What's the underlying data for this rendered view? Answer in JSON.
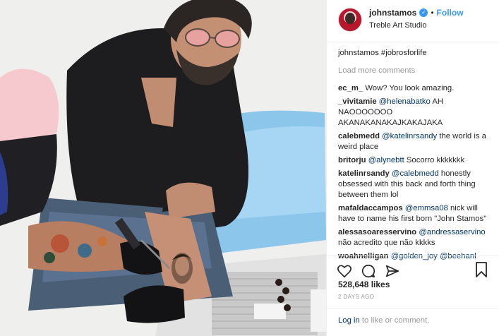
{
  "post": {
    "username": "johnstamos",
    "follow_label": "Follow",
    "separator": "•",
    "location": "Treble Art Studio",
    "verified_icon": "verified-badge-icon",
    "caption": {
      "user": "johnstamos",
      "text": "#jobrosforlife"
    },
    "load_more": "Load more comments",
    "likes": "528,648 likes",
    "timestamp": "2 DAYS AGO",
    "login_link": "Log in",
    "login_rest": " to like or comment."
  },
  "comments": [
    {
      "user": "ec_m_",
      "text": " Wow? You look amazing."
    },
    {
      "user": "_vivitamie",
      "mention": "@helenabatko",
      "text": " AH NAOOOOOOO AKANAKANAKAJKAKAJAKA"
    },
    {
      "user": "calebmedd",
      "mention": "@katelinrsandy",
      "text": " the world is a weird place"
    },
    {
      "user": "britorju",
      "mention": "@alynebtt",
      "text": " Socorro kkkkkkk"
    },
    {
      "user": "katelinrsandy",
      "mention": "@calebmedd",
      "text": " honestly obsessed with this back and forth thing between them lol"
    },
    {
      "user": "mafaldaccampos",
      "mention": "@emmsa08",
      "text": " nick will have to name his first born \"John Stamos\""
    },
    {
      "user": "alessasoaresservino",
      "mention": "@andressaservino",
      "text": " não acredito que não kkkks"
    },
    {
      "user": "woahnelligan",
      "mention": "@golden_joy @beehanl",
      "text": ""
    }
  ],
  "icons": {
    "like": "heart-icon",
    "comment": "comment-bubble-icon",
    "share": "share-arrow-icon",
    "save": "bookmark-icon"
  },
  "colors": {
    "link_blue": "#3897f0",
    "mention_blue": "#003569",
    "muted": "#999999",
    "divider": "#efefef"
  }
}
